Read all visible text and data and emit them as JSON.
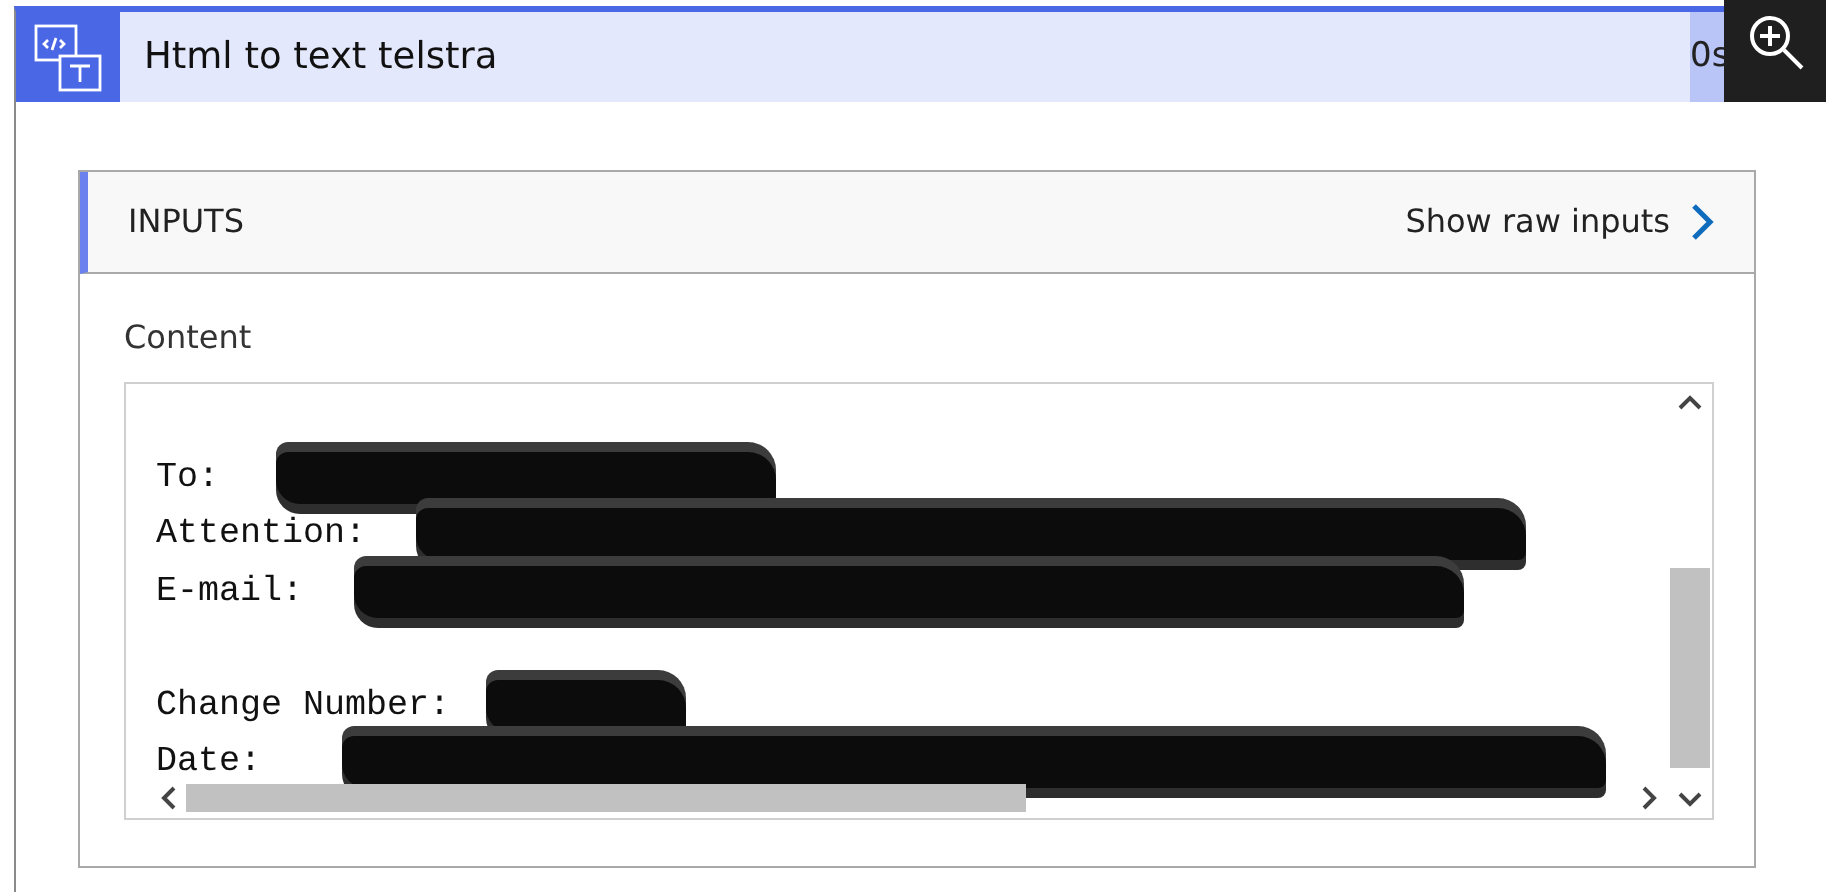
{
  "action": {
    "title": "Html to text telstra",
    "duration": "0s"
  },
  "inputs": {
    "title": "INPUTS",
    "raw_link": "Show raw inputs",
    "content_label": "Content",
    "lines": [
      {
        "label": "To:",
        "redacted": true,
        "blank_line_before": true
      },
      {
        "label": "Attention:",
        "redacted": true,
        "blank_line_before": false
      },
      {
        "label": "E-mail:",
        "redacted": true,
        "blank_line_before": false
      },
      {
        "label": "Change Number:",
        "redacted": true,
        "blank_line_before": true
      },
      {
        "label": "Date:",
        "redacted": true,
        "blank_line_before": false
      }
    ]
  }
}
